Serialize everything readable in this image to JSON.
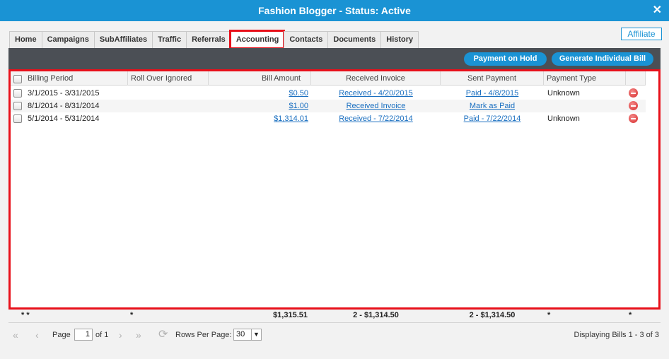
{
  "window": {
    "title": "Fashion Blogger - Status: Active",
    "close_icon": "close-icon"
  },
  "tabs": [
    {
      "label": "Home"
    },
    {
      "label": "Campaigns"
    },
    {
      "label": "SubAffiliates"
    },
    {
      "label": "Traffic"
    },
    {
      "label": "Referrals"
    },
    {
      "label": "Accounting",
      "active": true
    },
    {
      "label": "Contacts"
    },
    {
      "label": "Documents"
    },
    {
      "label": "History"
    }
  ],
  "affiliate_label": "Affiliate",
  "toolbar": {
    "payment_on_hold": "Payment on Hold",
    "generate_bill": "Generate Individual Bill"
  },
  "columns": {
    "billing_period": "Billing Period",
    "roll_over": "Roll Over Ignored",
    "bill_amount": "Bill Amount",
    "received_invoice": "Received Invoice",
    "sent_payment": "Sent Payment",
    "payment_type": "Payment Type"
  },
  "rows": [
    {
      "period": "3/1/2015 - 3/31/2015",
      "roll_over": "",
      "amount": "$0.50",
      "received": "Received - 4/20/2015",
      "sent": "Paid - 4/8/2015",
      "type": "Unknown"
    },
    {
      "period": "8/1/2014 - 8/31/2014",
      "roll_over": "",
      "amount": "$1.00",
      "received": "Received Invoice",
      "sent": "Mark as Paid",
      "type": ""
    },
    {
      "period": "5/1/2014 - 5/31/2014",
      "roll_over": "",
      "amount": "$1,314.01",
      "received": "Received - 7/22/2014",
      "sent": "Paid - 7/22/2014",
      "type": "Unknown"
    }
  ],
  "summary": {
    "period": "* *",
    "roll_over": "*",
    "amount": "$1,315.51",
    "received": "2 - $1,314.50",
    "sent": "2 - $1,314.50",
    "type": "*",
    "action": "*"
  },
  "pager": {
    "page_label": "Page",
    "page_value": "1",
    "of_label": "of 1",
    "rows_per_page_label": "Rows Per Page:",
    "rows_per_page_value": "30",
    "display_text": "Displaying Bills 1 - 3 of 3"
  }
}
